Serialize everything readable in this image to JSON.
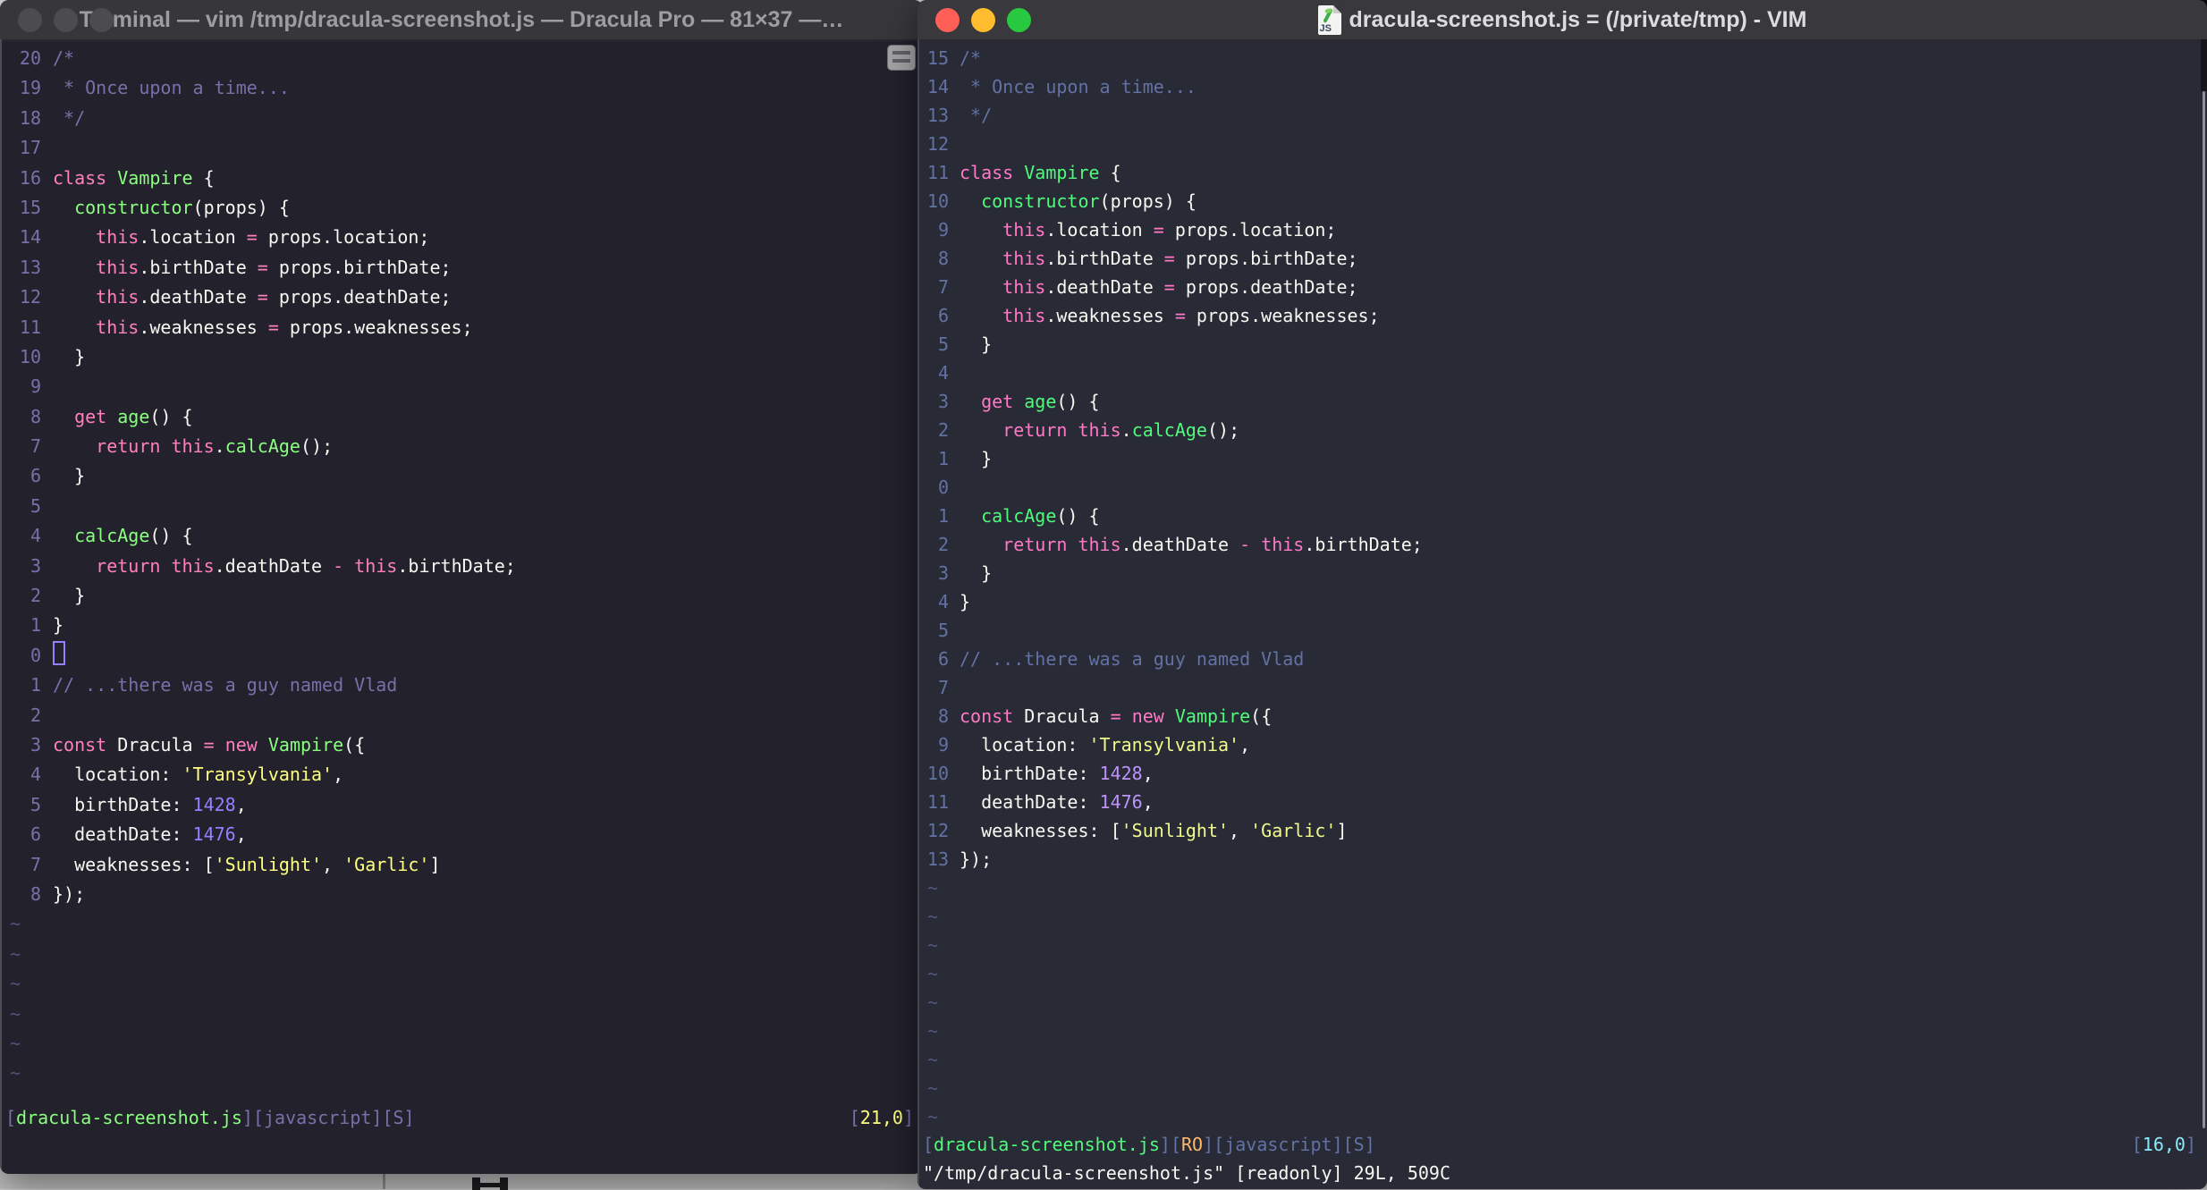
{
  "desktop": {
    "background_top": "#d8d7d8",
    "background_bottom": "#c3c2c3"
  },
  "left_window": {
    "title": "Terminal — vim /tmp/dracula-screenshot.js — Dracula Pro — 81×37 —…",
    "active": false,
    "titlebar_bg": "#373639",
    "title_color": "#9d9da0",
    "inactive_light_color": "#4c4b4e",
    "palette": {
      "bg": "#22212C",
      "fg": "#F8F8F2",
      "num": "#7970A9",
      "comment": "#7970A9",
      "pink": "#FF80BF",
      "green": "#8AFF80",
      "yellow": "#FFFF80",
      "purple": "#9580FF",
      "tilde": "#565077",
      "cursor": "#9580FF"
    },
    "tilde_count": 6,
    "lines": [
      {
        "n": "20",
        "s": [
          [
            "comment",
            "/*"
          ]
        ]
      },
      {
        "n": "19",
        "s": [
          [
            "comment",
            " * Once upon a time..."
          ]
        ]
      },
      {
        "n": "18",
        "s": [
          [
            "comment",
            " */"
          ]
        ]
      },
      {
        "n": "17",
        "s": []
      },
      {
        "n": "16",
        "s": [
          [
            "pink",
            "class"
          ],
          [
            "fg",
            " "
          ],
          [
            "green",
            "Vampire"
          ],
          [
            "fg",
            " {"
          ]
        ]
      },
      {
        "n": "15",
        "s": [
          [
            "fg",
            "  "
          ],
          [
            "green",
            "constructor"
          ],
          [
            "fg",
            "(props) {"
          ]
        ]
      },
      {
        "n": "14",
        "s": [
          [
            "fg",
            "    "
          ],
          [
            "pink",
            "this"
          ],
          [
            "fg",
            ".location "
          ],
          [
            "pink",
            "="
          ],
          [
            "fg",
            " props.location;"
          ]
        ]
      },
      {
        "n": "13",
        "s": [
          [
            "fg",
            "    "
          ],
          [
            "pink",
            "this"
          ],
          [
            "fg",
            ".birthDate "
          ],
          [
            "pink",
            "="
          ],
          [
            "fg",
            " props.birthDate;"
          ]
        ]
      },
      {
        "n": "12",
        "s": [
          [
            "fg",
            "    "
          ],
          [
            "pink",
            "this"
          ],
          [
            "fg",
            ".deathDate "
          ],
          [
            "pink",
            "="
          ],
          [
            "fg",
            " props.deathDate;"
          ]
        ]
      },
      {
        "n": "11",
        "s": [
          [
            "fg",
            "    "
          ],
          [
            "pink",
            "this"
          ],
          [
            "fg",
            ".weaknesses "
          ],
          [
            "pink",
            "="
          ],
          [
            "fg",
            " props.weaknesses;"
          ]
        ]
      },
      {
        "n": "10",
        "s": [
          [
            "fg",
            "  }"
          ]
        ]
      },
      {
        "n": "9",
        "s": []
      },
      {
        "n": "8",
        "s": [
          [
            "fg",
            "  "
          ],
          [
            "pink",
            "get"
          ],
          [
            "fg",
            " "
          ],
          [
            "green",
            "age"
          ],
          [
            "fg",
            "() {"
          ]
        ]
      },
      {
        "n": "7",
        "s": [
          [
            "fg",
            "    "
          ],
          [
            "pink",
            "return"
          ],
          [
            "fg",
            " "
          ],
          [
            "pink",
            "this"
          ],
          [
            "fg",
            "."
          ],
          [
            "green",
            "calcAge"
          ],
          [
            "fg",
            "();"
          ]
        ]
      },
      {
        "n": "6",
        "s": [
          [
            "fg",
            "  }"
          ]
        ]
      },
      {
        "n": "5",
        "s": []
      },
      {
        "n": "4",
        "s": [
          [
            "fg",
            "  "
          ],
          [
            "green",
            "calcAge"
          ],
          [
            "fg",
            "() {"
          ]
        ]
      },
      {
        "n": "3",
        "s": [
          [
            "fg",
            "    "
          ],
          [
            "pink",
            "return"
          ],
          [
            "fg",
            " "
          ],
          [
            "pink",
            "this"
          ],
          [
            "fg",
            ".deathDate "
          ],
          [
            "pink",
            "-"
          ],
          [
            "fg",
            " "
          ],
          [
            "pink",
            "this"
          ],
          [
            "fg",
            ".birthDate;"
          ]
        ]
      },
      {
        "n": "2",
        "s": [
          [
            "fg",
            "  }"
          ]
        ]
      },
      {
        "n": "1",
        "s": [
          [
            "fg",
            "}"
          ]
        ]
      },
      {
        "n": "0",
        "cursor": true,
        "s": []
      },
      {
        "n": "1",
        "s": [
          [
            "comment",
            "// ...there was a guy named Vlad"
          ]
        ]
      },
      {
        "n": "2",
        "s": []
      },
      {
        "n": "3",
        "s": [
          [
            "pink",
            "const"
          ],
          [
            "fg",
            " Dracula "
          ],
          [
            "pink",
            "="
          ],
          [
            "fg",
            " "
          ],
          [
            "pink",
            "new"
          ],
          [
            "fg",
            " "
          ],
          [
            "green",
            "Vampire"
          ],
          [
            "fg",
            "({"
          ]
        ]
      },
      {
        "n": "4",
        "s": [
          [
            "fg",
            "  location: "
          ],
          [
            "yellow",
            "'Transylvania'"
          ],
          [
            "fg",
            ","
          ]
        ]
      },
      {
        "n": "5",
        "s": [
          [
            "fg",
            "  birthDate: "
          ],
          [
            "purple",
            "1428"
          ],
          [
            "fg",
            ","
          ]
        ]
      },
      {
        "n": "6",
        "s": [
          [
            "fg",
            "  deathDate: "
          ],
          [
            "purple",
            "1476"
          ],
          [
            "fg",
            ","
          ]
        ]
      },
      {
        "n": "7",
        "s": [
          [
            "fg",
            "  weaknesses: ["
          ],
          [
            "yellow",
            "'Sunlight'"
          ],
          [
            "fg",
            ", "
          ],
          [
            "yellow",
            "'Garlic'"
          ],
          [
            "fg",
            "]"
          ]
        ]
      },
      {
        "n": "8",
        "s": [
          [
            "fg",
            "});"
          ]
        ]
      }
    ],
    "statusline": {
      "left": [
        [
          "num",
          "["
        ],
        [
          "green",
          "dracula-screenshot.js"
        ],
        [
          "num",
          "][javascript][S]"
        ]
      ],
      "right": [
        [
          "num",
          "["
        ],
        [
          "yellow",
          "21,0"
        ],
        [
          "num",
          "]"
        ]
      ]
    },
    "cmdline": ""
  },
  "right_window": {
    "title": "dracula-screenshot.js = (/private/tmp) - VIM",
    "active": true,
    "doc_icon_label": "JS",
    "titlebar_bg": "#39383c",
    "title_color": "#dcdcdc",
    "traffic_lights": {
      "close": "#FF5F57",
      "minimize": "#FEBC2E",
      "zoom": "#28C840"
    },
    "palette": {
      "bg": "#282A36",
      "fg": "#F8F8F2",
      "num": "#6272A4",
      "comment": "#6272A4",
      "pink": "#FF79C6",
      "green": "#50FA7B",
      "yellow": "#F1FA8C",
      "purple": "#BD93F9",
      "cyan": "#8BE9FD",
      "orange": "#FFB86C",
      "tilde": "#4d5878"
    },
    "tilde_count": 9,
    "lines": [
      {
        "n": "15",
        "s": [
          [
            "comment",
            "/*"
          ]
        ]
      },
      {
        "n": "14",
        "s": [
          [
            "comment",
            " * Once upon a time..."
          ]
        ]
      },
      {
        "n": "13",
        "s": [
          [
            "comment",
            " */"
          ]
        ]
      },
      {
        "n": "12",
        "s": []
      },
      {
        "n": "11",
        "s": [
          [
            "pink",
            "class"
          ],
          [
            "fg",
            " "
          ],
          [
            "green",
            "Vampire"
          ],
          [
            "fg",
            " {"
          ]
        ]
      },
      {
        "n": "10",
        "s": [
          [
            "fg",
            "  "
          ],
          [
            "green",
            "constructor"
          ],
          [
            "fg",
            "(props) {"
          ]
        ]
      },
      {
        "n": "9",
        "s": [
          [
            "fg",
            "    "
          ],
          [
            "pink",
            "this"
          ],
          [
            "fg",
            ".location "
          ],
          [
            "pink",
            "="
          ],
          [
            "fg",
            " props.location;"
          ]
        ]
      },
      {
        "n": "8",
        "s": [
          [
            "fg",
            "    "
          ],
          [
            "pink",
            "this"
          ],
          [
            "fg",
            ".birthDate "
          ],
          [
            "pink",
            "="
          ],
          [
            "fg",
            " props.birthDate;"
          ]
        ]
      },
      {
        "n": "7",
        "s": [
          [
            "fg",
            "    "
          ],
          [
            "pink",
            "this"
          ],
          [
            "fg",
            ".deathDate "
          ],
          [
            "pink",
            "="
          ],
          [
            "fg",
            " props.deathDate;"
          ]
        ]
      },
      {
        "n": "6",
        "s": [
          [
            "fg",
            "    "
          ],
          [
            "pink",
            "this"
          ],
          [
            "fg",
            ".weaknesses "
          ],
          [
            "pink",
            "="
          ],
          [
            "fg",
            " props.weaknesses;"
          ]
        ]
      },
      {
        "n": "5",
        "s": [
          [
            "fg",
            "  }"
          ]
        ]
      },
      {
        "n": "4",
        "s": []
      },
      {
        "n": "3",
        "s": [
          [
            "fg",
            "  "
          ],
          [
            "pink",
            "get"
          ],
          [
            "fg",
            " "
          ],
          [
            "green",
            "age"
          ],
          [
            "fg",
            "() {"
          ]
        ]
      },
      {
        "n": "2",
        "s": [
          [
            "fg",
            "    "
          ],
          [
            "pink",
            "return"
          ],
          [
            "fg",
            " "
          ],
          [
            "pink",
            "this"
          ],
          [
            "fg",
            "."
          ],
          [
            "green",
            "calcAge"
          ],
          [
            "fg",
            "();"
          ]
        ]
      },
      {
        "n": "1",
        "s": [
          [
            "fg",
            "  }"
          ]
        ]
      },
      {
        "n": "0",
        "s": []
      },
      {
        "n": "1",
        "s": [
          [
            "fg",
            "  "
          ],
          [
            "green",
            "calcAge"
          ],
          [
            "fg",
            "() {"
          ]
        ]
      },
      {
        "n": "2",
        "s": [
          [
            "fg",
            "    "
          ],
          [
            "pink",
            "return"
          ],
          [
            "fg",
            " "
          ],
          [
            "pink",
            "this"
          ],
          [
            "fg",
            ".deathDate "
          ],
          [
            "pink",
            "-"
          ],
          [
            "fg",
            " "
          ],
          [
            "pink",
            "this"
          ],
          [
            "fg",
            ".birthDate;"
          ]
        ]
      },
      {
        "n": "3",
        "s": [
          [
            "fg",
            "  }"
          ]
        ]
      },
      {
        "n": "4",
        "s": [
          [
            "fg",
            "}"
          ]
        ]
      },
      {
        "n": "5",
        "s": []
      },
      {
        "n": "6",
        "s": [
          [
            "comment",
            "// ...there was a guy named Vlad"
          ]
        ]
      },
      {
        "n": "7",
        "s": []
      },
      {
        "n": "8",
        "s": [
          [
            "pink",
            "const"
          ],
          [
            "fg",
            " Dracula "
          ],
          [
            "pink",
            "="
          ],
          [
            "fg",
            " "
          ],
          [
            "pink",
            "new"
          ],
          [
            "fg",
            " "
          ],
          [
            "green",
            "Vampire"
          ],
          [
            "fg",
            "({"
          ]
        ]
      },
      {
        "n": "9",
        "s": [
          [
            "fg",
            "  location: "
          ],
          [
            "yellow",
            "'Transylvania'"
          ],
          [
            "fg",
            ","
          ]
        ]
      },
      {
        "n": "10",
        "s": [
          [
            "fg",
            "  birthDate: "
          ],
          [
            "purple",
            "1428"
          ],
          [
            "fg",
            ","
          ]
        ]
      },
      {
        "n": "11",
        "s": [
          [
            "fg",
            "  deathDate: "
          ],
          [
            "purple",
            "1476"
          ],
          [
            "fg",
            ","
          ]
        ]
      },
      {
        "n": "12",
        "s": [
          [
            "fg",
            "  weaknesses: ["
          ],
          [
            "yellow",
            "'Sunlight'"
          ],
          [
            "fg",
            ", "
          ],
          [
            "yellow",
            "'Garlic'"
          ],
          [
            "fg",
            "]"
          ]
        ]
      },
      {
        "n": "13",
        "s": [
          [
            "fg",
            "});"
          ]
        ]
      }
    ],
    "statusline": {
      "left": [
        [
          "num",
          "["
        ],
        [
          "green",
          "dracula-screenshot.js"
        ],
        [
          "num",
          "]["
        ],
        [
          "orange",
          "RO"
        ],
        [
          "num",
          "][javascript][S]"
        ]
      ],
      "right": [
        [
          "num",
          "["
        ],
        [
          "cyan",
          "16,0"
        ],
        [
          "num",
          "]"
        ]
      ]
    },
    "cmdline": "\"/tmp/dracula-screenshot.js\" [readonly] 29L, 509C"
  }
}
